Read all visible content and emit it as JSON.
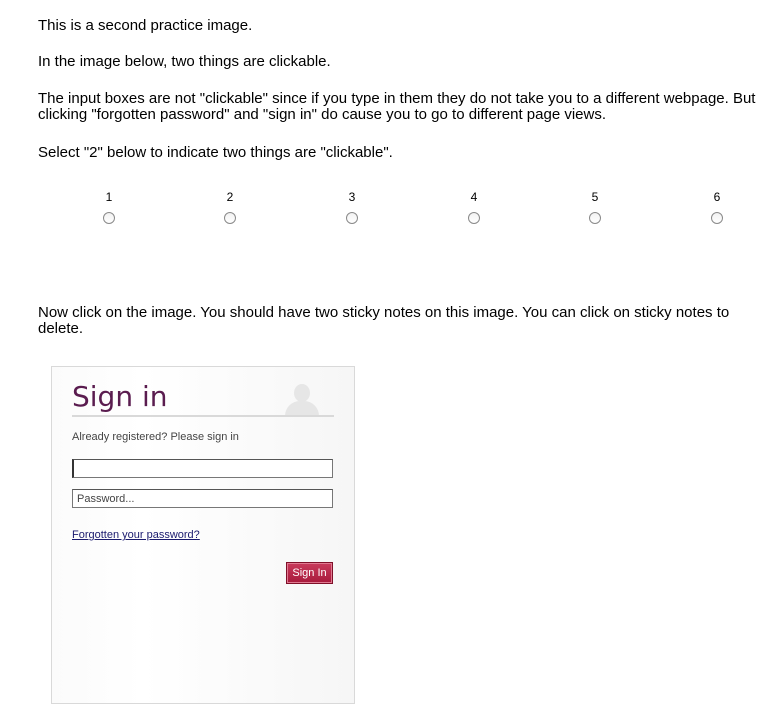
{
  "instructions": {
    "p1": "This is a second practice image.",
    "p2": "In the image below, two things are clickable.",
    "p3": "The input boxes are not \"clickable\" since if you type in them they do not take you to a different webpage. But clicking \"forgotten password\" and \"sign in\" do cause you to go to different page views.",
    "p4": "Select \"2\" below to indicate two things are \"clickable\".",
    "p5": "Now click on the image. You should have two sticky notes on this image. You can click on sticky notes to delete."
  },
  "scale": {
    "options": [
      "1",
      "2",
      "3",
      "4",
      "5",
      "6"
    ],
    "selected": null
  },
  "signin_image": {
    "title": "Sign in",
    "subtitle": "Already registered? Please sign in",
    "login_value": "",
    "password_placeholder": "Password...",
    "forgot_link": "Forgotten your password?",
    "button_label": "Sign In",
    "avatar_icon": "user-silhouette-icon",
    "colors": {
      "title": "#5a1c4f",
      "button": "#b8254a",
      "link": "#1a1a6e"
    }
  }
}
